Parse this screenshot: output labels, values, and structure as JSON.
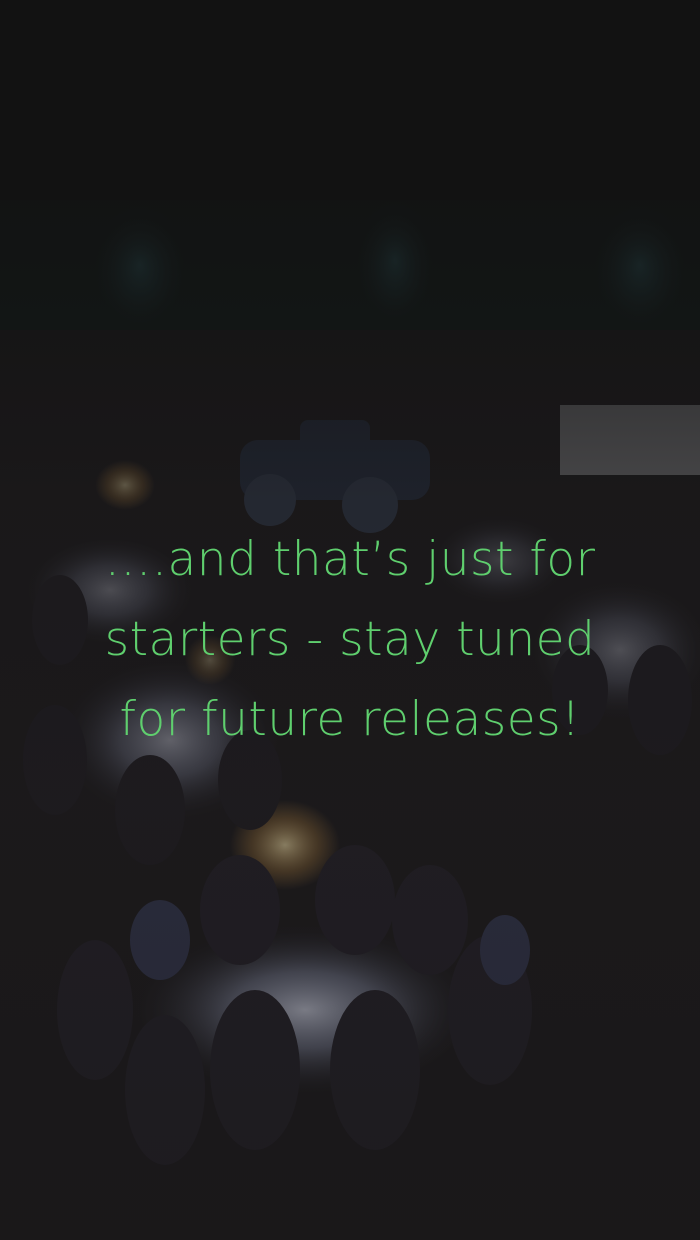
{
  "promo": {
    "message_line1": "….and that’s just for",
    "message_line2": "starters - stay tuned",
    "message_line3": "for future releases!"
  },
  "colors": {
    "text_accent": "#5fcf6e",
    "background": "#121212"
  },
  "background_image": {
    "subject": "outdoor night dinner party with round tables, candelabras, guests and vintage cars"
  }
}
